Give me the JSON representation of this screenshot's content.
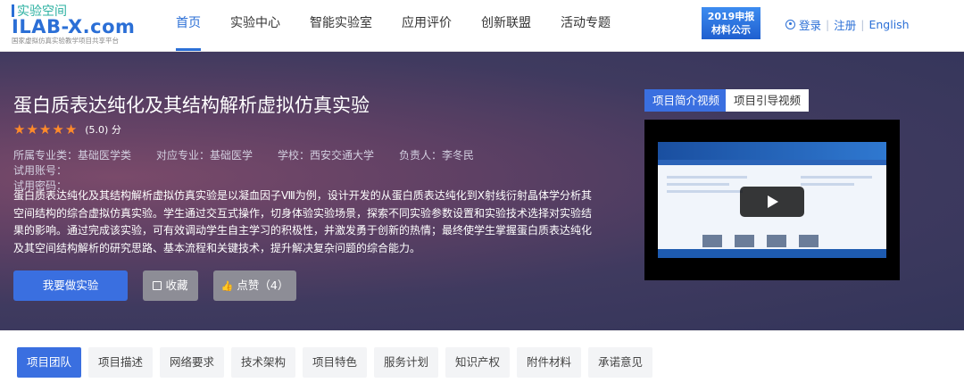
{
  "logo": {
    "top_text": "实验空间",
    "main_text": "ILAB-X.com",
    "sub_text": "国家虚拟仿真实验教学项目共享平台"
  },
  "nav": {
    "items": [
      {
        "label": "首页",
        "active": true
      },
      {
        "label": "实验中心",
        "active": false
      },
      {
        "label": "智能实验室",
        "active": false
      },
      {
        "label": "应用评价",
        "active": false
      },
      {
        "label": "创新联盟",
        "active": false
      },
      {
        "label": "活动专题",
        "active": false
      }
    ]
  },
  "promo_badge": {
    "line1": "2019申报",
    "line2": "材料公示"
  },
  "auth": {
    "login": "登录",
    "register": "注册",
    "language": "English"
  },
  "project": {
    "title": "蛋白质表达纯化及其结构解析虚拟仿真实验",
    "rating_value": 5.0,
    "rating_text": "(5.0) 分",
    "stars": 5,
    "meta": {
      "major_category": "所属专业类：基础医学类",
      "major": "对应专业：基础医学",
      "school": "学校：西安交通大学",
      "owner": "负责人：李冬民",
      "trial_account": "试用账号：",
      "trial_password": "试用密码："
    },
    "description": "蛋白质表达纯化及其结构解析虚拟仿真实验是以凝血因子Ⅷ为例，设计开发的从蛋白质表达纯化到X射线衍射晶体学分析其空间结构的综合虚拟仿真实验。学生通过交互式操作，切身体验实验场景，探索不同实验参数设置和实验技术选择对实验结果的影响。通过完成该实验，可有效调动学生自主学习的积极性，并激发勇于创新的热情；最终使学生掌握蛋白质表达纯化及其空间结构解析的研究思路、基本流程和关键技术，提升解决复杂问题的综合能力。",
    "buttons": {
      "start": "我要做实验",
      "favorite": "收藏",
      "like": "点赞（4）"
    }
  },
  "video": {
    "tabs": [
      {
        "label": "项目简介视频",
        "active": true
      },
      {
        "label": "项目引导视频",
        "active": false
      }
    ]
  },
  "bottom_tabs": [
    {
      "label": "项目团队",
      "active": true
    },
    {
      "label": "项目描述",
      "active": false
    },
    {
      "label": "网络要求",
      "active": false
    },
    {
      "label": "技术架构",
      "active": false
    },
    {
      "label": "项目特色",
      "active": false
    },
    {
      "label": "服务计划",
      "active": false
    },
    {
      "label": "知识产权",
      "active": false
    },
    {
      "label": "附件材料",
      "active": false
    },
    {
      "label": "承诺意见",
      "active": false
    }
  ],
  "colors": {
    "accent": "#3a6fe0",
    "star": "#ff8a2a",
    "hero_bg": "#3f3a5f"
  }
}
